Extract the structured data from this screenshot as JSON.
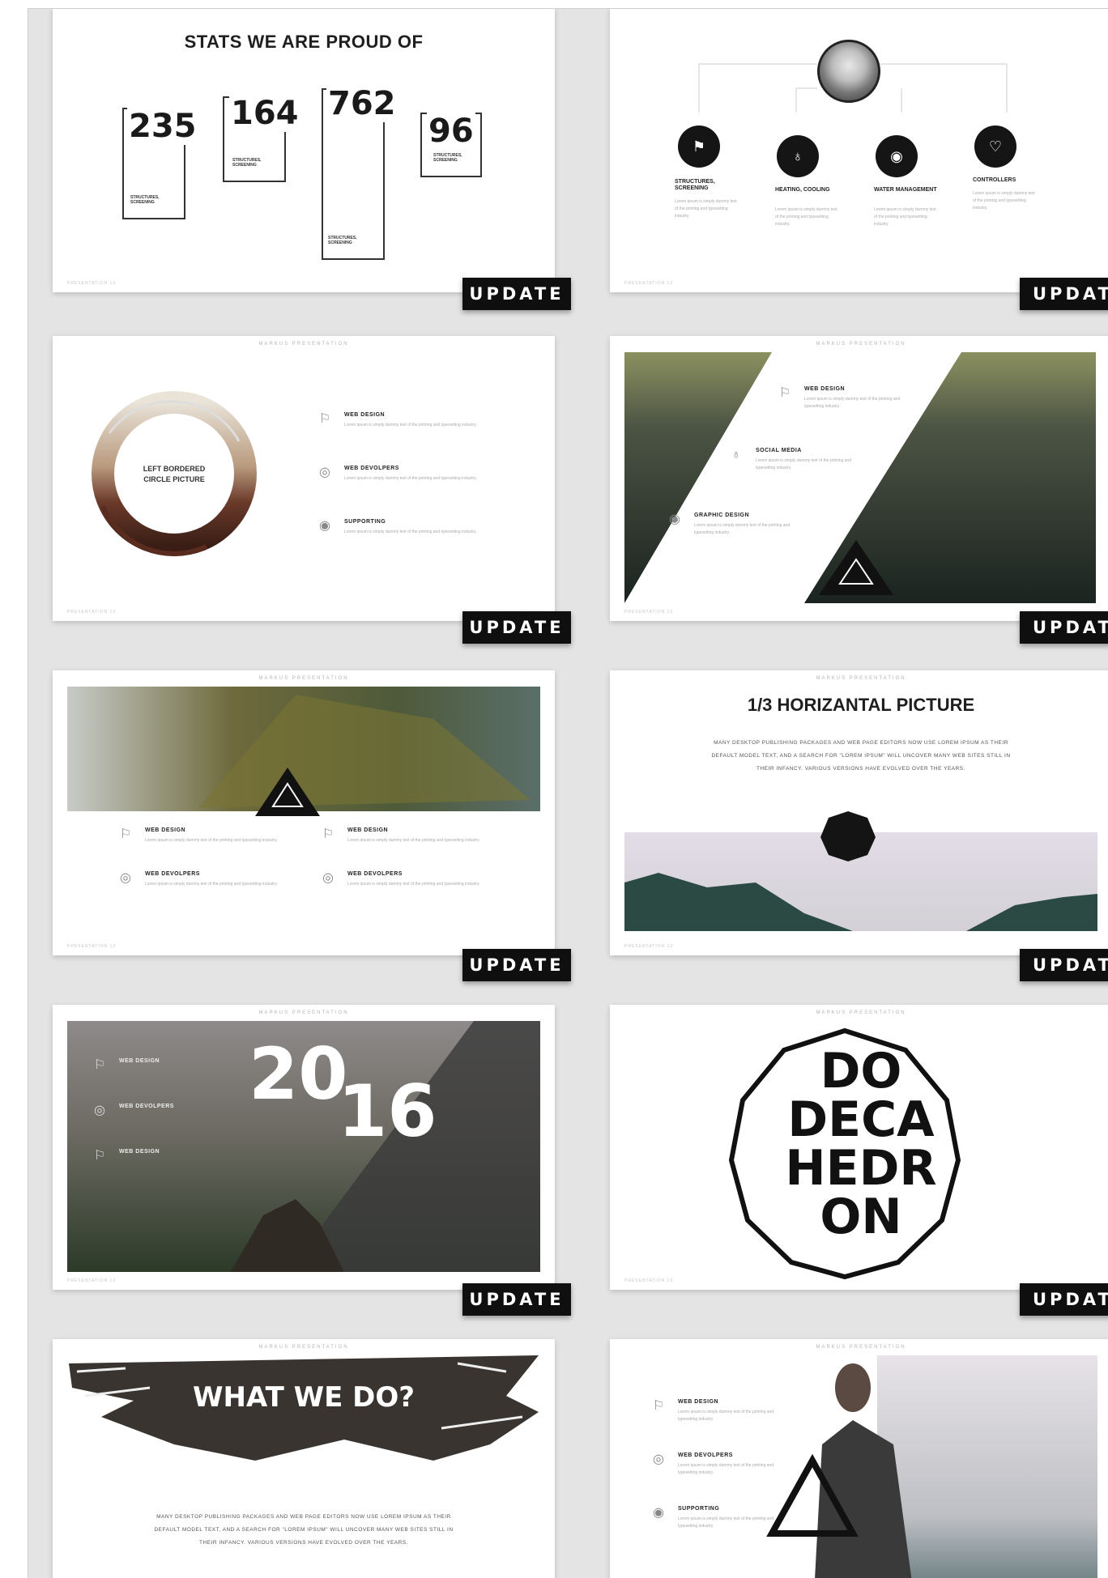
{
  "update_label": "UPDATE",
  "kicker": "MARKUS PRESENTATION",
  "footer": "PRESENTATION 12",
  "stats": {
    "title": "STATS WE ARE PROUD OF",
    "items": [
      {
        "value": "235",
        "label": "STRUCTURES, SCREENING"
      },
      {
        "value": "164",
        "label": "STRUCTURES, SCREENING"
      },
      {
        "value": "762",
        "label": "STRUCTURES, SCREENING"
      },
      {
        "value": "96",
        "label": "STRUCTURES, SCREENING"
      }
    ]
  },
  "org": {
    "nodes": [
      {
        "title": "STRUCTURES, SCREENING",
        "icon": "⚑",
        "icon_name": "flag-icon"
      },
      {
        "title": "HEATING, COOLING",
        "icon": "♁",
        "icon_name": "pin-icon"
      },
      {
        "title": "WATER MANAGEMENT",
        "icon": "◉",
        "icon_name": "eye-icon"
      },
      {
        "title": "CONTROLLERS",
        "icon": "♡",
        "icon_name": "heart-icon"
      }
    ],
    "node_text": "Lorem ipsum is simply dummy text of the printing and typesetting industry."
  },
  "circle_slide": {
    "circle_label_1": "LEFT BORDERED",
    "circle_label_2": "CIRCLE PICTURE",
    "features": [
      {
        "title": "WEB DESIGN",
        "icon": "⚐"
      },
      {
        "title": "WEB DEVOLPERS",
        "icon": "◎"
      },
      {
        "title": "SUPPORTING",
        "icon": "◉"
      }
    ],
    "feature_text": "Lorem ipsum is simply dummy text of the printing and typesetting industry."
  },
  "forest_slide": {
    "features": [
      {
        "title": "WEB DESIGN",
        "icon": "⚐"
      },
      {
        "title": "SOCIAL MEDIA",
        "icon": "♁"
      },
      {
        "title": "GRAPHIC DESIGN",
        "icon": "◉"
      }
    ]
  },
  "mountain_slide": {
    "features": [
      {
        "title": "WEB DESIGN",
        "icon": "⚐"
      },
      {
        "title": "WEB DESIGN",
        "icon": "⚐"
      },
      {
        "title": "WEB DEVOLPERS",
        "icon": "◎"
      },
      {
        "title": "WEB DEVOLPERS",
        "icon": "◎"
      }
    ]
  },
  "horiz_slide": {
    "title": "1/3 HORIZANTAL PICTURE",
    "body_lines": [
      "MANY DESKTOP PUBLISHING PACKAGES AND WEB PAGE EDITORS NOW USE LOREM IPSUM AS THEIR",
      "DEFAULT MODEL TEXT, AND A SEARCH FOR \"LOREM IPSUM\" WILL UNCOVER MANY WEB SITES STILL IN",
      "THEIR INFANCY. VARIOUS VERSIONS HAVE EVOLVED OVER THE YEARS."
    ]
  },
  "year_slide": {
    "year_a": "20",
    "year_b": "16",
    "features": [
      {
        "title": "WEB DESIGN",
        "icon": "⚐"
      },
      {
        "title": "WEB DEVOLPERS",
        "icon": "◎"
      },
      {
        "title": "WEB DESIGN",
        "icon": "⚐"
      }
    ]
  },
  "dodeca_slide": {
    "lines": [
      "DO",
      "DECA",
      "HEDR",
      "ON"
    ]
  },
  "what_slide": {
    "title": "WHAT WE DO?",
    "body_lines": [
      "MANY DESKTOP PUBLISHING PACKAGES AND WEB PAGE EDITORS NOW USE LOREM IPSUM AS THEIR",
      "DEFAULT MODEL TEXT, AND A SEARCH FOR \"LOREM IPSUM\" WILL UNCOVER MANY WEB SITES STILL IN",
      "THEIR INFANCY. VARIOUS VERSIONS HAVE EVOLVED OVER THE YEARS."
    ]
  },
  "portrait_slide": {
    "features": [
      {
        "title": "WEB DESIGN",
        "icon": "⚐"
      },
      {
        "title": "WEB DEVOLPERS",
        "icon": "◎"
      },
      {
        "title": "SUPPORTING",
        "icon": "◉"
      }
    ]
  }
}
